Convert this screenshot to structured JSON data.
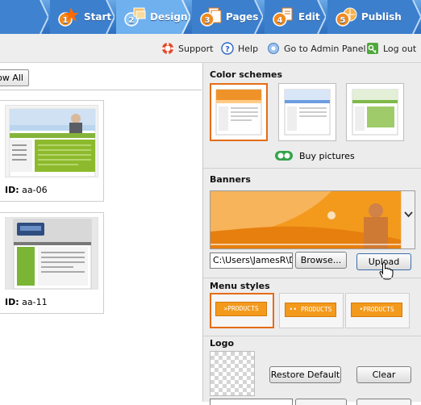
{
  "wizard": {
    "steps": [
      {
        "num": "1",
        "label": "Start"
      },
      {
        "num": "2",
        "label": "Design"
      },
      {
        "num": "3",
        "label": "Pages"
      },
      {
        "num": "4",
        "label": "Edit"
      },
      {
        "num": "5",
        "label": "Publish"
      }
    ],
    "active_step": "Design"
  },
  "toolbar": {
    "support": "Support",
    "help": "Help",
    "admin": "Go to Admin Panel",
    "logout": "Log out"
  },
  "left": {
    "show_all": "ow All",
    "templates": [
      {
        "id_label": "ID:",
        "id_value": "aa-06"
      },
      {
        "id_label": "ID:",
        "id_value": "aa-11"
      }
    ]
  },
  "right": {
    "color_schemes": {
      "title": "Color schemes",
      "swatches": [
        {
          "accent": "#f0922a",
          "selected": true
        },
        {
          "accent": "#6c9de0",
          "selected": false
        },
        {
          "accent": "#7fb84a",
          "selected": false
        }
      ],
      "buy": "Buy pictures"
    },
    "banners": {
      "title": "Banners",
      "file_value": "C:\\Users\\JamesR\\D",
      "browse": "Browse...",
      "upload": "Upload"
    },
    "menu_styles": {
      "title": "Menu styles",
      "items": [
        "»PRODUCTS",
        "•• PRODUCTS",
        "•PRODUCTS"
      ]
    },
    "logo": {
      "title": "Logo",
      "restore": "Restore Default",
      "clear": "Clear"
    }
  },
  "colors": {
    "wizard_blue": "#3f82cf",
    "accent_orange": "#e46c17"
  }
}
